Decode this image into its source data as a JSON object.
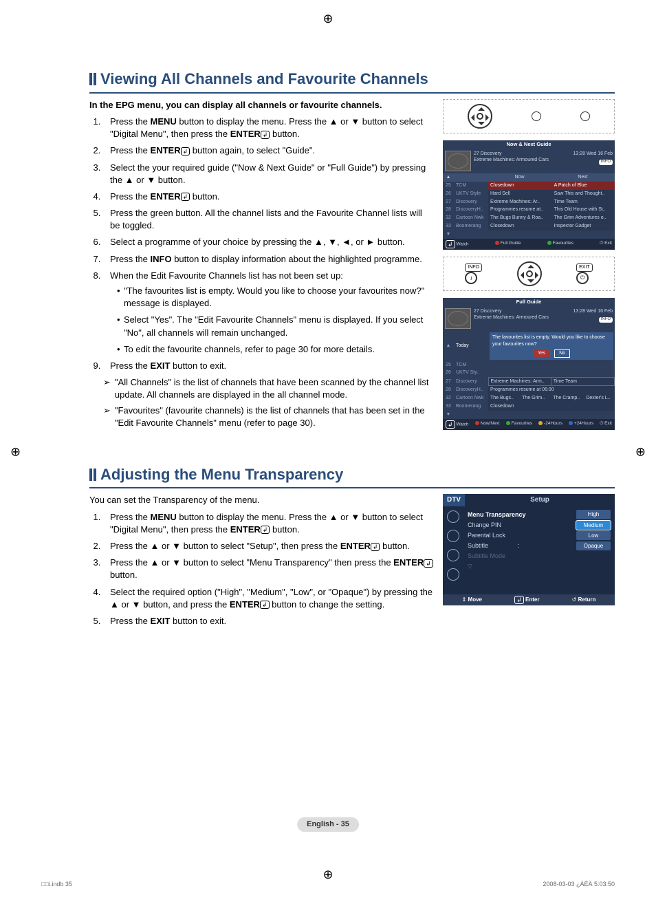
{
  "section1": {
    "title": "Viewing All Channels and Favourite Channels",
    "intro": "In the EPG menu, you can display all channels or favourite channels.",
    "steps": {
      "s1a": "Press the ",
      "s1b": "MENU",
      "s1c": " button to display the menu. Press the ▲ or ▼ button to select \"Digital Menu\", then press the ",
      "s1d": "ENTER",
      "s1e": " button.",
      "s2a": "Press the ",
      "s2b": "ENTER",
      "s2c": " button again, to select \"Guide\".",
      "s3": "Select the your required guide (\"Now & Next Guide\" or \"Full Guide\") by pressing the ▲ or ▼ button.",
      "s4a": "Press the ",
      "s4b": "ENTER",
      "s4c": " button.",
      "s5": "Press the green button. All the channel lists and the Favourite Channel lists will be toggled.",
      "s6": "Select a programme of your choice by pressing the ▲, ▼, ◄, or ► button.",
      "s7a": "Press the ",
      "s7b": "INFO",
      "s7c": " button to display information about the highlighted programme.",
      "s8": "When the Edit Favourite Channels list has not been set up:",
      "s8_b1": "\"The favourites list is empty. Would you like to choose your favourites now?\" message is displayed.",
      "s8_b2": "Select \"Yes\". The \"Edit Favourite Channels\" menu is displayed. If you select \"No\", all channels will remain unchanged.",
      "s8_b3": "To edit the favourite channels, refer to page 30 for more details.",
      "s9a": "Press the ",
      "s9b": "EXIT",
      "s9c": " button to exit."
    },
    "notes": {
      "n1": "\"All Channels\" is the list of channels that have been scanned by the channel list update. All channels are displayed in the all channel mode.",
      "n2": "\"Favourites\" (favourite channels) is the list of channels that has been set in the \"Edit Favourite Channels\" menu (refer to page 30)."
    }
  },
  "epg1": {
    "title": "Now & Next Guide",
    "ch_line": "27 Discovery",
    "prog_line": "Extreme Machines: Armoured Cars",
    "time": "13:28 Wed 16 Feb",
    "info": "INFO",
    "col_now": "Now",
    "col_next": "Next",
    "rows": [
      {
        "num": "25",
        "name": "TCM",
        "now": "Closedown",
        "next": "A Patch of Blue",
        "sel": true
      },
      {
        "num": "26",
        "name": "UKTV Style",
        "now": "Hard Sell",
        "next": "Saw This and Thought..",
        "sel": false
      },
      {
        "num": "27",
        "name": "Discovery",
        "now": "Extreme Machines: Ar..",
        "next": "Time Team",
        "sel": false
      },
      {
        "num": "28",
        "name": "DiscoveryH..",
        "now": "Programmes resume at..",
        "next": "This Old House with St..",
        "sel": false
      },
      {
        "num": "32",
        "name": "Cartoon Nwk",
        "now": "The Bugs Bunny & Roa..",
        "next": "The Grim Adventures o..",
        "sel": false
      },
      {
        "num": "33",
        "name": "Boomerang",
        "now": "Closedown",
        "next": "Inspector Gadget",
        "sel": false
      }
    ],
    "footer": {
      "watch": "Watch",
      "full": "Full Guide",
      "fav": "Favourites",
      "exit": "Exit"
    }
  },
  "remote_labels": {
    "info": "INFO",
    "exit": "EXIT"
  },
  "epg2": {
    "title": "Full Guide",
    "ch_line": "27 Discovery",
    "prog_line": "Extreme Machines: Armoured Cars",
    "time": "13:28 Wed 16 Feb",
    "info": "INFO",
    "today": "Today",
    "confirm_msg": "The favourites list is empty. Would you like to choose your favourites now?",
    "yes": "Yes",
    "no": "No",
    "rows": [
      {
        "num": "25",
        "name": "TCM"
      },
      {
        "num": "26",
        "name": "UKTV Sty.."
      },
      {
        "num": "27",
        "name": "Discovery",
        "p1": "Extreme Machines: Arm..",
        "p2": "Time Team"
      },
      {
        "num": "28",
        "name": "DiscoveryH..",
        "p1": "Programmes resume at 06:00"
      },
      {
        "num": "32",
        "name": "Cartoon Nwk",
        "p1": "The Bugs..",
        "p2": "The Grim..",
        "p3": "The Cramp..",
        "p4": "Dexter's L.."
      },
      {
        "num": "33",
        "name": "Boomerang",
        "p1": "Closedown"
      }
    ],
    "footer": {
      "watch": "Watch",
      "nn": "Now/Next",
      "fav": "Favourites",
      "m24": "-24Hours",
      "p24": "+24Hours",
      "exit": "Exit"
    }
  },
  "section2": {
    "title": "Adjusting the Menu Transparency",
    "intro": "You can set the Transparency of the menu.",
    "steps": {
      "s1a": "Press the ",
      "s1b": "MENU",
      "s1c": " button to display the menu. Press the ▲ or ▼ button to select \"Digital Menu\", then press the ",
      "s1d": "ENTER",
      "s1e": " button.",
      "s2a": "Press the ▲ or ▼ button to select \"Setup\", then press the ",
      "s2b": "ENTER",
      "s2c": " button.",
      "s3a": "Press the ▲ or ▼ button to select \"Menu Transparency\" then press the ",
      "s3b": "ENTER",
      "s3c": " button.",
      "s4a": "Select the required option (\"High\", \"Medium\", \"Low\", or \"Opaque\") by pressing the ▲ or ▼ button, and press the ",
      "s4b": "ENTER",
      "s4c": " button to change the setting.",
      "s5a": "Press the ",
      "s5b": "EXIT",
      "s5c": " button to exit."
    }
  },
  "setup_menu": {
    "dtv": "DTV",
    "title": "Setup",
    "items": {
      "transparency": "Menu Transparency",
      "pin": "Change PIN",
      "parental": "Parental Lock",
      "subtitle": "Subtitle",
      "subtitle_mode": "Subtitle  Mode"
    },
    "options": {
      "high": "High",
      "medium": "Medium",
      "low": "Low",
      "opaque": "Opaque"
    },
    "subtitle_colon": ":",
    "nav_arrow": "▽",
    "footer": {
      "move": "Move",
      "enter": "Enter",
      "return": "Return",
      "move_icon": "⇕",
      "enter_icon": "↲",
      "return_icon": "↺"
    }
  },
  "page_number": "English - 35",
  "footer": {
    "left": "□□i.indb   35",
    "right": "2008-03-03   ¿ÀÈÄ 5:03:50"
  }
}
